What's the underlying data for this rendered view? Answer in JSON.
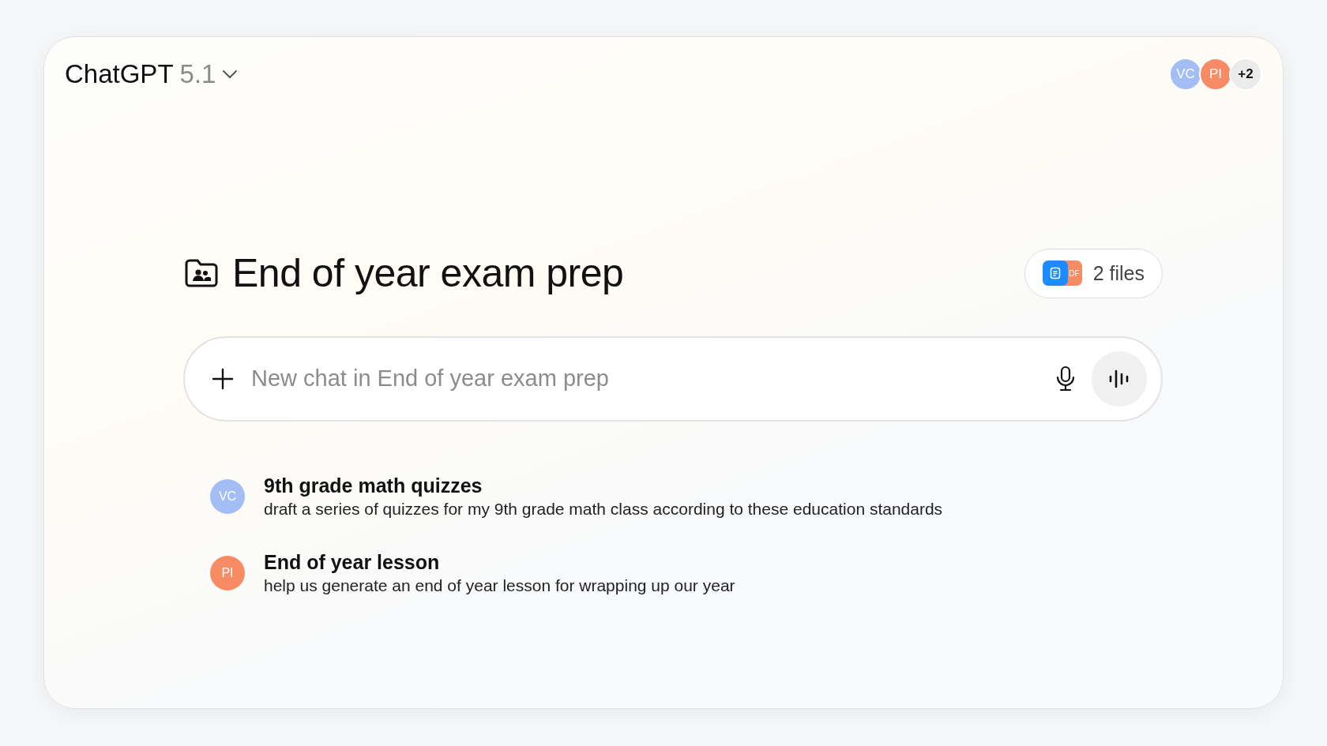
{
  "header": {
    "model_name": "ChatGPT",
    "model_version": "5.1"
  },
  "members": [
    {
      "initials": "VC",
      "color": "#a3bdf5"
    },
    {
      "initials": "PI",
      "color": "#f78b63"
    }
  ],
  "members_more": "+2",
  "project": {
    "title": "End of year exam prep",
    "files_label": "2 files",
    "files": [
      {
        "kind": "doc",
        "color": "#1a8cff"
      },
      {
        "kind": "pdf",
        "label": "DF",
        "color": "#f78b63"
      }
    ]
  },
  "composer": {
    "placeholder": "New chat in End of year exam prep"
  },
  "chats": [
    {
      "initials": "VC",
      "color": "#a3bdf5",
      "title": "9th grade math quizzes",
      "snippet": "draft a series of quizzes for my 9th grade math class according to these education standards"
    },
    {
      "initials": "PI",
      "color": "#f78b63",
      "title": "End of year lesson",
      "snippet": "help us generate an end of year lesson for wrapping up our year"
    }
  ]
}
